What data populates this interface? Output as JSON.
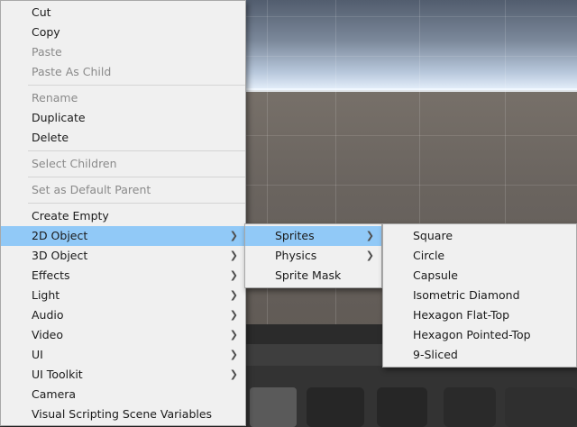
{
  "main_menu": {
    "items": [
      {
        "label": "Cut",
        "disabled": false
      },
      {
        "label": "Copy",
        "disabled": false
      },
      {
        "label": "Paste",
        "disabled": true
      },
      {
        "label": "Paste As Child",
        "disabled": true
      },
      {
        "label": "Rename",
        "disabled": true
      },
      {
        "label": "Duplicate",
        "disabled": false
      },
      {
        "label": "Delete",
        "disabled": false
      },
      {
        "label": "Select Children",
        "disabled": true
      },
      {
        "label": "Set as Default Parent",
        "disabled": true
      },
      {
        "label": "Create Empty",
        "disabled": false
      },
      {
        "label": "2D Object",
        "submenu": true,
        "selected": true
      },
      {
        "label": "3D Object",
        "submenu": true
      },
      {
        "label": "Effects",
        "submenu": true
      },
      {
        "label": "Light",
        "submenu": true
      },
      {
        "label": "Audio",
        "submenu": true
      },
      {
        "label": "Video",
        "submenu": true
      },
      {
        "label": "UI",
        "submenu": true
      },
      {
        "label": "UI Toolkit",
        "submenu": true
      },
      {
        "label": "Camera",
        "disabled": false
      },
      {
        "label": "Visual Scripting Scene Variables",
        "disabled": false
      }
    ]
  },
  "submenu_2d": {
    "items": [
      {
        "label": "Sprites",
        "submenu": true,
        "selected": true
      },
      {
        "label": "Physics",
        "submenu": true
      },
      {
        "label": "Sprite Mask"
      }
    ]
  },
  "submenu_sprites": {
    "items": [
      {
        "label": "Square"
      },
      {
        "label": "Circle"
      },
      {
        "label": "Capsule"
      },
      {
        "label": "Isometric Diamond"
      },
      {
        "label": "Hexagon Flat-Top"
      },
      {
        "label": "Hexagon Pointed-Top"
      },
      {
        "label": "9-Sliced"
      }
    ]
  },
  "colors": {
    "menu_bg": "#f0f0f0",
    "highlight": "#91c9f7",
    "disabled_text": "#8a8a8a"
  },
  "icons": {
    "submenu_arrow": "chevron-right-icon"
  }
}
